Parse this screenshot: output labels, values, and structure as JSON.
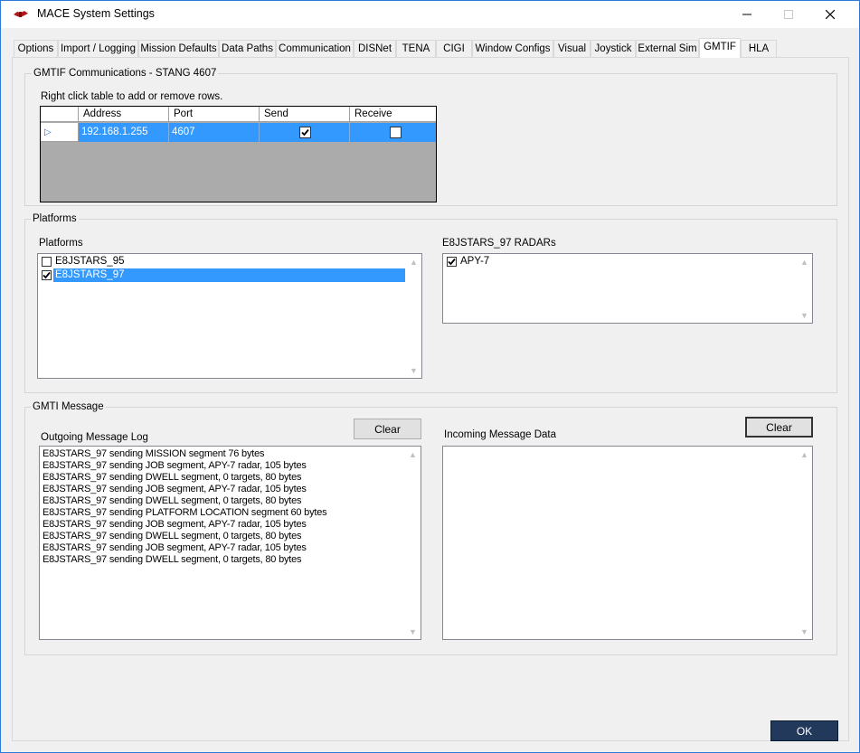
{
  "window": {
    "title": "MACE System Settings",
    "minimize_glyph": "—",
    "maximize_glyph": "☐",
    "close_glyph": "✕"
  },
  "tabs": [
    {
      "label": "Options",
      "active": false
    },
    {
      "label": "Import / Logging",
      "active": false
    },
    {
      "label": "Mission Defaults",
      "active": false
    },
    {
      "label": "Data Paths",
      "active": false
    },
    {
      "label": "Communication",
      "active": false
    },
    {
      "label": "DISNet",
      "active": false
    },
    {
      "label": "TENA",
      "active": false
    },
    {
      "label": "CIGI",
      "active": false
    },
    {
      "label": "Window Configs",
      "active": false
    },
    {
      "label": "Visual",
      "active": false
    },
    {
      "label": "Joystick",
      "active": false
    },
    {
      "label": "External Sim",
      "active": false
    },
    {
      "label": "GMTIF",
      "active": true
    },
    {
      "label": "HLA",
      "active": false
    }
  ],
  "comms": {
    "group_title": "GMTIF Communications - STANG 4607",
    "hint": "Right click table to add or remove rows.",
    "columns": [
      "Address",
      "Port",
      "Send",
      "Receive"
    ],
    "rows": [
      {
        "address": "192.168.1.255",
        "port": "4607",
        "send": true,
        "receive": false
      }
    ],
    "row_indicator": "▷"
  },
  "platforms": {
    "group_title": "Platforms",
    "list_label": "Platforms",
    "items": [
      {
        "name": "E8JSTARS_95",
        "checked": false,
        "selected": false
      },
      {
        "name": "E8JSTARS_97",
        "checked": true,
        "selected": true
      }
    ],
    "radars_label": "E8JSTARS_97 RADARs",
    "radars": [
      {
        "name": "APY-7",
        "checked": true
      }
    ]
  },
  "gmti": {
    "group_title": "GMTI Message",
    "outgoing_label": "Outgoing Message Log",
    "incoming_label": "Incoming Message Data",
    "clear_outgoing": "Clear",
    "clear_incoming": "Clear",
    "log": [
      "E8JSTARS_97 sending MISSION segment 76 bytes",
      "E8JSTARS_97 sending JOB segment, APY-7 radar, 105 bytes",
      "E8JSTARS_97 sending DWELL segment, 0 targets, 80 bytes",
      "E8JSTARS_97 sending JOB segment, APY-7 radar, 105 bytes",
      "E8JSTARS_97 sending DWELL segment, 0 targets, 80 bytes",
      "E8JSTARS_97 sending PLATFORM LOCATION segment 60 bytes",
      "E8JSTARS_97 sending JOB segment, APY-7 radar, 105 bytes",
      "E8JSTARS_97 sending DWELL segment, 0 targets, 80 bytes",
      "E8JSTARS_97 sending JOB segment, APY-7 radar, 105 bytes",
      "E8JSTARS_97 sending DWELL segment, 0 targets, 80 bytes"
    ],
    "incoming_text": ""
  },
  "footer": {
    "ok_label": "OK"
  },
  "colors": {
    "selection": "#3399ff",
    "window_border": "#2b79d8",
    "ok_button": "#23395b"
  }
}
